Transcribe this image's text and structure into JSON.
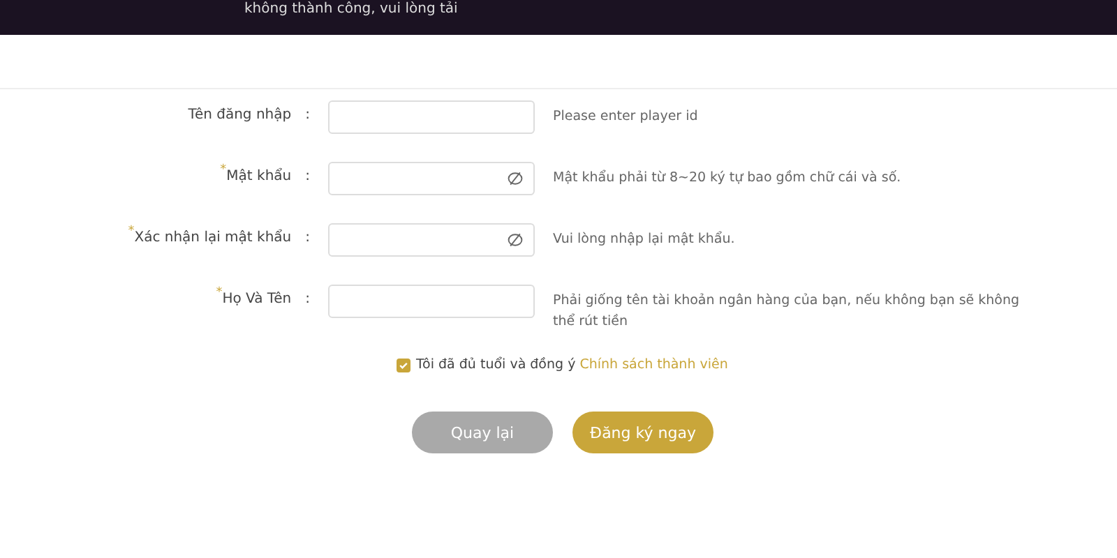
{
  "banner": {
    "text": "không thành công, vui lòng tải"
  },
  "required_symbol": "*",
  "fields": [
    {
      "label": "Tên đăng nhập",
      "required": false,
      "kind": "text",
      "colon": ":",
      "hint": "Please enter player id"
    },
    {
      "label": "Mật khẩu",
      "required": true,
      "kind": "password",
      "colon": ":",
      "hint": "Mật khẩu phải từ 8~20 ký tự bao gồm chữ cái và số."
    },
    {
      "label": "Xác nhận lại mật khẩu",
      "required": true,
      "kind": "password",
      "colon": ":",
      "hint": "Vui lòng nhập lại mật khẩu."
    },
    {
      "label": "Họ Và Tên",
      "required": true,
      "kind": "text",
      "colon": ":",
      "hint": "Phải giống tên tài khoản ngân hàng của bạn, nếu không bạn sẽ không thể rút tiền"
    }
  ],
  "agree": {
    "checked": true,
    "text": "Tôi đã đủ tuổi và đồng ý",
    "link": "Chính sách thành viên"
  },
  "buttons": [
    {
      "label": "Quay lại",
      "kind": "secondary"
    },
    {
      "label": "Đăng ký ngay",
      "kind": "primary"
    }
  ]
}
